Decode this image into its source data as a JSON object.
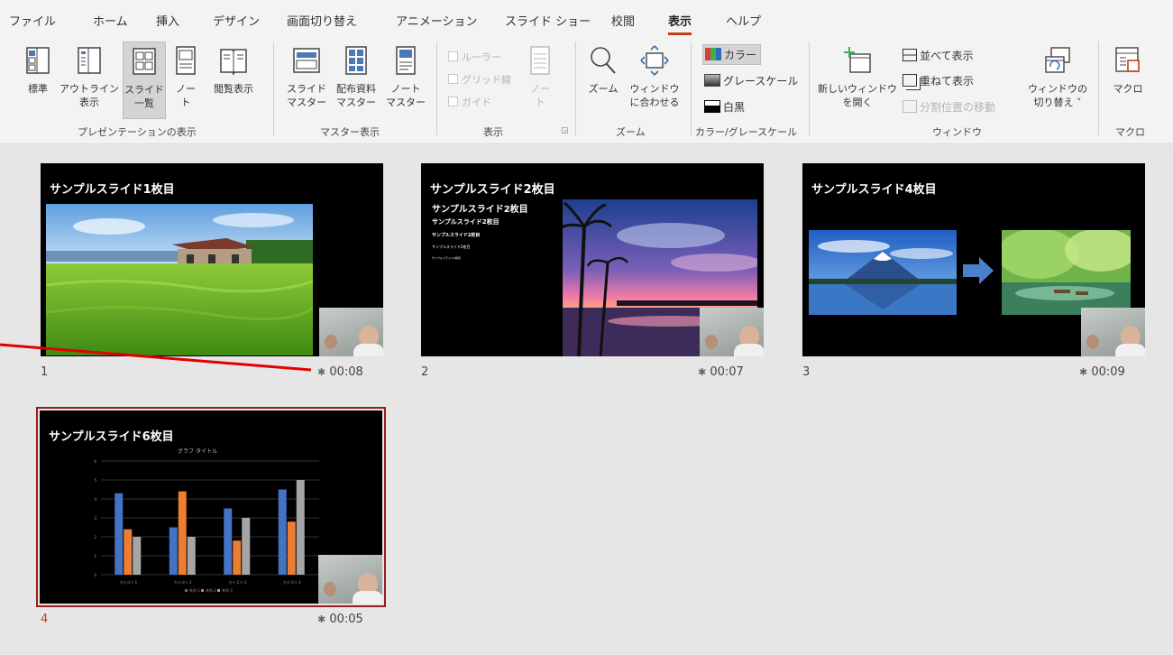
{
  "menu": {
    "tabs": [
      "ファイル",
      "ホーム",
      "挿入",
      "デザイン",
      "画面切り替え",
      "アニメーション",
      "スライド ショー",
      "校閲",
      "表示",
      "ヘルプ"
    ],
    "active": "表示"
  },
  "ribbon": {
    "presentation_views": {
      "group_label": "プレゼンテーションの表示",
      "normal": "標準",
      "outline_1": "アウトライン",
      "outline_2": "表示",
      "sorter_1": "スライド",
      "sorter_2": "一覧",
      "notes_1": "ノー",
      "notes_2": "ト",
      "reading": "閲覧表示"
    },
    "master_views": {
      "group_label": "マスター表示",
      "slide_master_1": "スライド",
      "slide_master_2": "マスター",
      "handout_1": "配布資料",
      "handout_2": "マスター",
      "notes_master_1": "ノート",
      "notes_master_2": "マスター"
    },
    "show": {
      "group_label": "表示",
      "ruler": "ルーラー",
      "gridlines": "グリッド線",
      "guides": "ガイド",
      "notes_1": "ノー",
      "notes_2": "ト"
    },
    "zoom": {
      "group_label": "ズーム",
      "zoom": "ズーム",
      "fit_1": "ウィンドウ",
      "fit_2": "に合わせる"
    },
    "color": {
      "group_label": "カラー/グレースケール",
      "color": "カラー",
      "grayscale": "グレースケール",
      "bw": "白黒"
    },
    "window": {
      "group_label": "ウィンドウ",
      "new_1": "新しいウィンドウ",
      "new_2": "を開く",
      "arrange": "並べて表示",
      "cascade": "重ねて表示",
      "move_split": "分割位置の移動",
      "switch_1": "ウィンドウの",
      "switch_2": "切り替え ˅"
    },
    "macro": {
      "group_label": "マクロ",
      "macro": "マクロ"
    }
  },
  "slides": [
    {
      "num": "1",
      "time": "00:08",
      "title": "サンプルスライド1枚目"
    },
    {
      "num": "2",
      "time": "00:07",
      "title": "サンプルスライド2枚目",
      "body": [
        "サンプルスライド2枚目",
        "サンプルスライド2枚目",
        "サンプルスライド2枚目",
        "サンプルスライド2枚目",
        "サンプルスライド2枚目"
      ]
    },
    {
      "num": "3",
      "time": "00:09",
      "title": "サンプルスライド4枚目"
    },
    {
      "num": "4",
      "time": "00:05",
      "title": "サンプルスライド6枚目",
      "chart_title": "グラフ タイトル",
      "categories": [
        "カテゴリ 1",
        "カテゴリ 2",
        "カテゴリ 3",
        "カテゴリ 4"
      ],
      "legend": [
        "系列 1",
        "系列 2",
        "系列 3"
      ]
    }
  ],
  "chart_data": {
    "type": "bar",
    "title": "グラフ タイトル",
    "categories": [
      "カテゴリ 1",
      "カテゴリ 2",
      "カテゴリ 3",
      "カテゴリ 4"
    ],
    "series": [
      {
        "name": "系列 1",
        "values": [
          4.3,
          2.5,
          3.5,
          4.5
        ]
      },
      {
        "name": "系列 2",
        "values": [
          2.4,
          4.4,
          1.8,
          2.8
        ]
      },
      {
        "name": "系列 3",
        "values": [
          2.0,
          2.0,
          3.0,
          5.0
        ]
      }
    ],
    "ylim": [
      0,
      6
    ],
    "colors": [
      "#4472c4",
      "#ed7d31",
      "#a5a5a5"
    ]
  },
  "colors": {
    "accent": "#c43e1c",
    "annotation": "#e00000",
    "selected_border": "#9b1c1c"
  }
}
